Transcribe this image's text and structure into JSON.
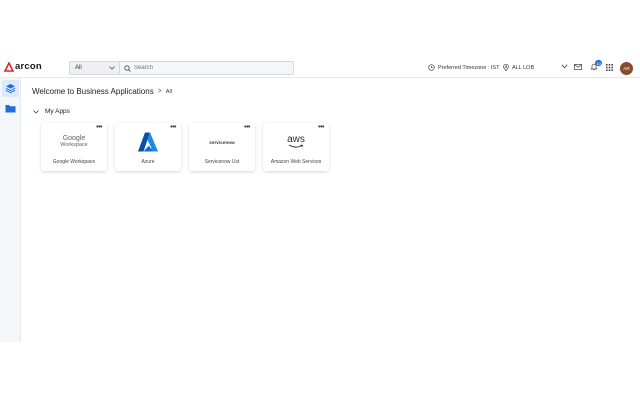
{
  "app": {
    "brand": "arcon"
  },
  "search": {
    "scope": "All",
    "placeholder": "Search"
  },
  "header": {
    "timezone": "Preferred Timezone : IST",
    "lob": "ALL LOB",
    "notification_count": "10",
    "avatar_initials": "AR"
  },
  "sidebar": {
    "items": [
      {
        "name": "applications",
        "active": true
      },
      {
        "name": "folder",
        "active": false
      }
    ]
  },
  "breadcrumb": {
    "title": "Welcome to Business Applications",
    "separator": ">",
    "current": "All"
  },
  "section": {
    "title": "My Apps"
  },
  "apps": [
    {
      "logo_line1": "Google",
      "logo_line2": "Workspace",
      "label": "Google Workspace"
    },
    {
      "label": "Azure"
    },
    {
      "logo_text": "servicenow",
      "label": "Servicenow Ust"
    },
    {
      "logo_text": "aws",
      "label": "Amazon Web Services"
    }
  ],
  "colors": {
    "accent": "#1e6fd9",
    "brand_red": "#d9262b",
    "azure_blue": "#0a6ed1",
    "avatar": "#8a4b2a"
  },
  "icons": {
    "more": "•••"
  }
}
